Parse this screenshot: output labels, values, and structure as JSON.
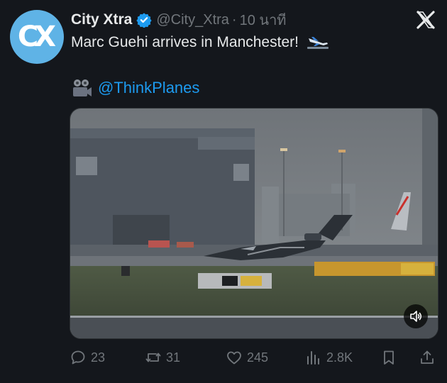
{
  "tweet": {
    "avatar_text": "CX",
    "display_name": "City Xtra",
    "handle": "@City_Xtra",
    "separator": "·",
    "time": "10 นาที",
    "text": "Marc Guehi arrives in Manchester!",
    "credit_mention": "@ThinkPlanes"
  },
  "icons": {
    "verified": "verified-badge-icon",
    "platform": "x-logo-icon",
    "plane_emoji": "airplane-arriving-icon",
    "camera_emoji": "movie-camera-icon",
    "mute": "speaker-icon"
  },
  "actions": {
    "replies": "23",
    "reposts": "31",
    "likes": "245",
    "views": "2.8K"
  },
  "colors": {
    "background": "#14171c",
    "accent": "#1d9bf0",
    "muted_text": "#71767b",
    "avatar_bg": "#5fb3e6"
  }
}
